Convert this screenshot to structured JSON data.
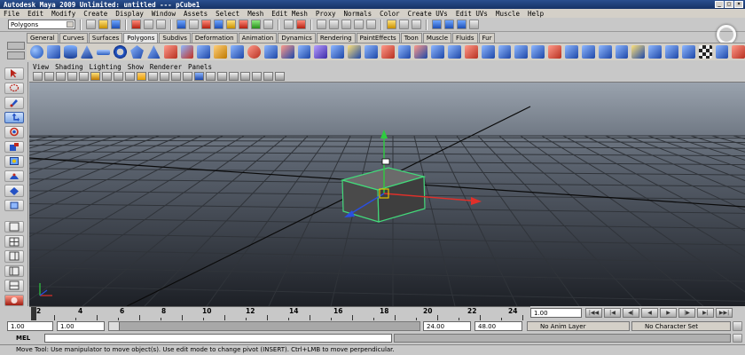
{
  "window": {
    "title": "Autodesk Maya 2009 Unlimited: untitled   ---   pCube1"
  },
  "menu": {
    "items": [
      "File",
      "Edit",
      "Modify",
      "Create",
      "Display",
      "Window",
      "Assets",
      "Select",
      "Mesh",
      "Edit Mesh",
      "Proxy",
      "Normals",
      "Color",
      "Create UVs",
      "Edit UVs",
      "Muscle",
      "Help"
    ]
  },
  "status_line": {
    "mode": "Polygons"
  },
  "shelf": {
    "tabs": [
      "General",
      "Curves",
      "Surfaces",
      "Polygons",
      "Subdivs",
      "Deformation",
      "Animation",
      "Dynamics",
      "Rendering",
      "PaintEffects",
      "Toon",
      "Muscle",
      "Fluids",
      "Fur"
    ],
    "active_tab": "Polygons"
  },
  "panel": {
    "menu": [
      "View",
      "Shading",
      "Lighting",
      "Show",
      "Renderer",
      "Panels"
    ]
  },
  "toolbox": {
    "tools": [
      "select-tool-icon",
      "lasso-tool-icon",
      "paint-select-icon",
      "move-tool-icon",
      "rotate-tool-icon",
      "scale-tool-icon",
      "universal-manip-icon",
      "soft-mod-icon",
      "show-manip-icon",
      "last-tool-icon"
    ]
  },
  "timeline": {
    "ticks": [
      "2",
      "4",
      "6",
      "8",
      "10",
      "12",
      "14",
      "16",
      "18",
      "20",
      "22",
      "24"
    ],
    "current_frame": "1.00"
  },
  "range": {
    "start_min": "1.00",
    "start": "1.00",
    "end": "24.00",
    "end_max": "48.00",
    "anim_layer": "No Anim Layer",
    "character_set": "No Character Set"
  },
  "command_line": {
    "label": "MEL"
  },
  "help_line": {
    "text": "Move Tool: Use manipulator to move object(s). Use edit mode to change pivot (INSERT). Ctrl+LMB to move perpendicular."
  },
  "colors": {
    "viewport_top": "#9aa3ae",
    "viewport_bottom": "#1d2026",
    "selection": "#43d97a",
    "x_axis": "#e0302a",
    "y_axis": "#2ecc40",
    "z_axis": "#2a4fe0"
  }
}
